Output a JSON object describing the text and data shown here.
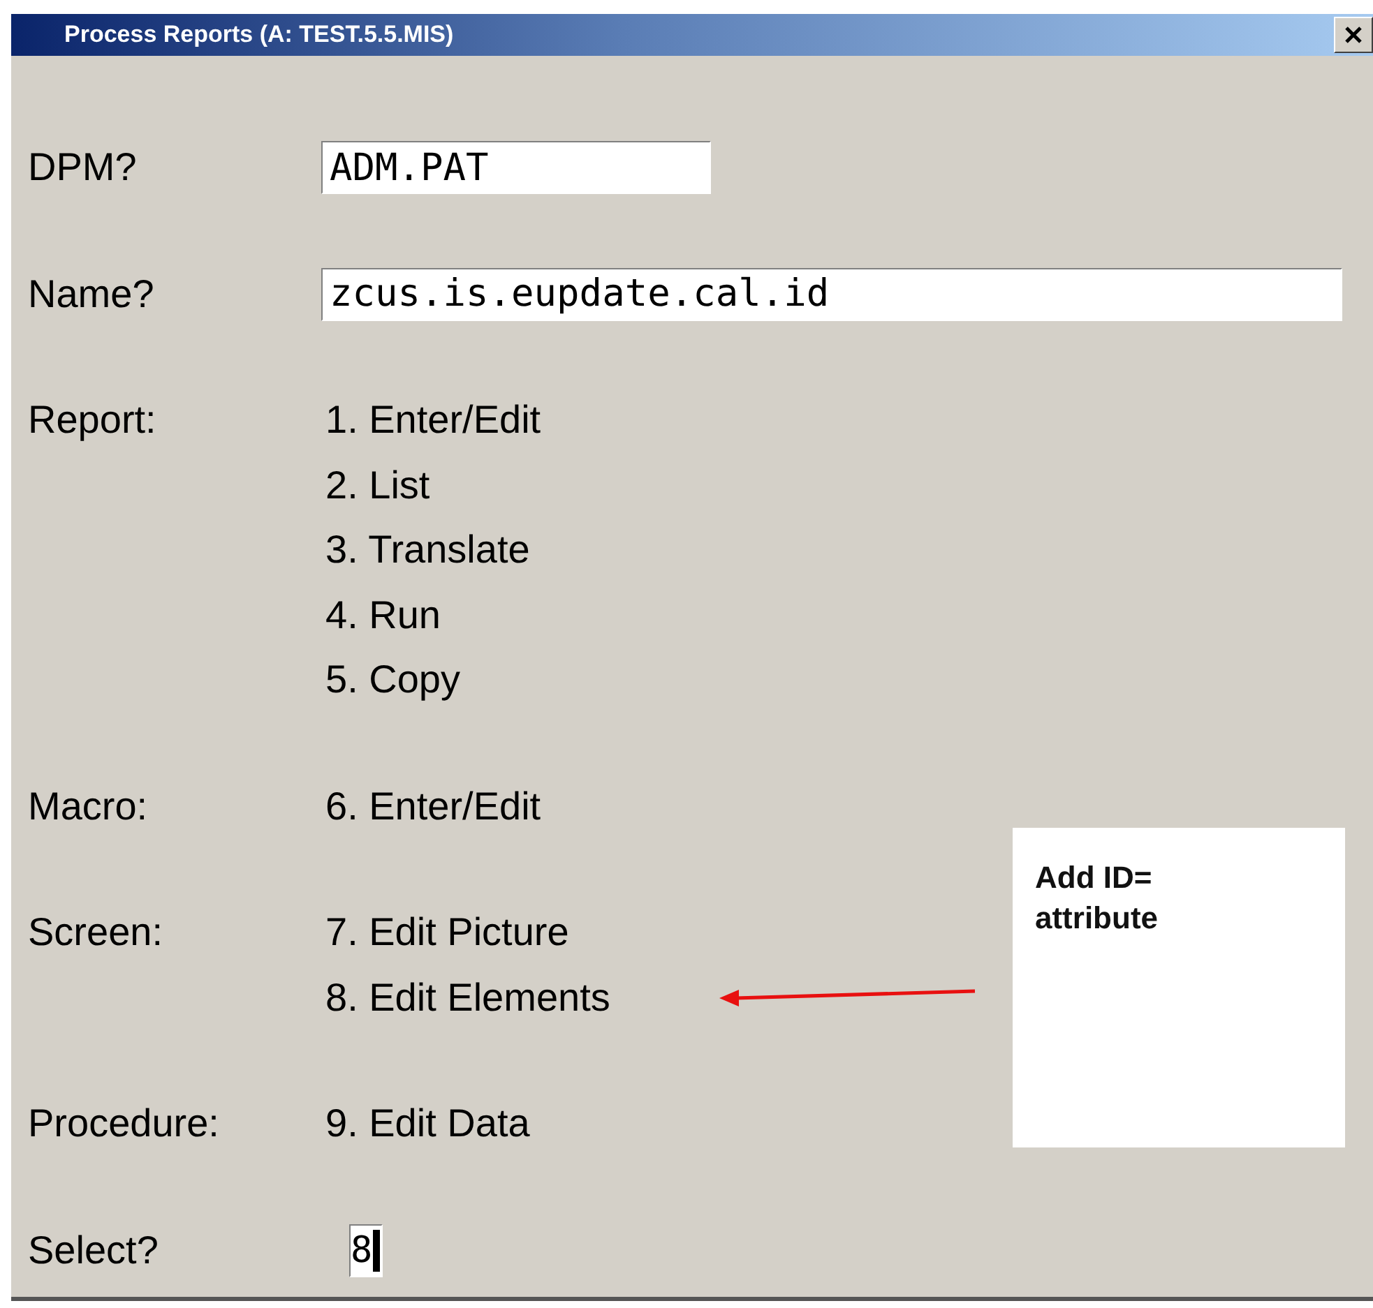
{
  "window": {
    "title": "Process Reports (A: TEST.5.5.MIS)"
  },
  "fields": [
    {
      "label": "DPM?",
      "value": "ADM.PAT",
      "kind": "short"
    },
    {
      "label": "Name?",
      "value": "zcus.is.eupdate.cal.id",
      "kind": "long"
    }
  ],
  "sections": [
    {
      "label": "Report:",
      "options": [
        "1. Enter/Edit",
        "2. List",
        "3. Translate",
        "4. Run",
        "5. Copy"
      ]
    },
    {
      "label": "Macro:",
      "options": [
        "6. Enter/Edit"
      ]
    },
    {
      "label": "Screen:",
      "options": [
        "7. Edit Picture",
        "8. Edit Elements"
      ]
    },
    {
      "label": "Procedure:",
      "options": [
        "9. Edit Data"
      ]
    }
  ],
  "select": {
    "label": "Select?",
    "value": "8"
  },
  "callout": {
    "text": "Add ID=\nattribute"
  }
}
